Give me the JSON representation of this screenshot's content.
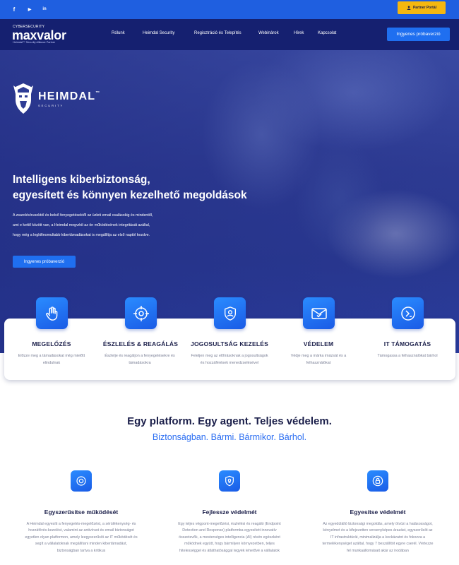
{
  "topbar": {
    "social": [
      {
        "name": "facebook",
        "glyph": "f"
      },
      {
        "name": "youtube",
        "glyph": "▶"
      },
      {
        "name": "linkedin",
        "glyph": "in"
      }
    ],
    "partner_label": "Partner Portál"
  },
  "nav": {
    "logo_small": "CYBERSECURITY",
    "logo_main": "maxvalor",
    "logo_tag": "Heimdal™ Security Alliance Partner",
    "items": [
      "Rólunk",
      "Heimdal Security",
      "Regisztráció és Telepítés",
      "Webinárok",
      "Hírek",
      "Kapcsolat"
    ],
    "cta": "Ingyenes próbaverzió"
  },
  "hero": {
    "brand": "HEIMDAL",
    "brand_tm": "™",
    "brand_sub": "SECURITY",
    "title_line1": "Intelligens kiberbiztonság,",
    "title_line2": "egyesített és könnyen kezelhető megoldások",
    "text_line1": "A zsarolóvírusoktól és belső fenyegetésektől az üzleti email csalásokig és mindentől,",
    "text_line2": "ami e kettő között van, a Heimdal megvédi az ön működésének integritását azáltal,",
    "text_line3": "hogy még a legkifinomultabb kibertámadásokat is megállítja az első naptól kezdve.",
    "button": "Ingyenes próbaverzió"
  },
  "features": [
    {
      "title": "MEGELŐZÉS",
      "desc": "Előzze meg a támadásokat még mielőtt elindulnak",
      "icon": "hand-icon"
    },
    {
      "title": "ÉSZLELÉS & REAGÁLÁS",
      "desc": "Észlelje és reagáljon a fenyegetésekre és támadásokra",
      "icon": "crosshair-icon"
    },
    {
      "title": "JOGOSULTSÁG KEZELÉS",
      "desc": "Feleljen meg az előírásoknak a jogosultságok és hozzáférések menedzselésével",
      "icon": "user-shield-icon"
    },
    {
      "title": "VÉDELEM",
      "desc": "Védje meg a márka imázsát és a felhasználókat",
      "icon": "mail-check-icon"
    },
    {
      "title": "IT TÁMOGATÁS",
      "desc": "Támogassa a felhasználókat bárhol",
      "icon": "remote-icon"
    }
  ],
  "platform": {
    "title": "Egy platform. Egy agent. Teljes védelem.",
    "subtitle": "Biztonságban. Bármi. Bármikor. Bárhol."
  },
  "columns": [
    {
      "title": "Egyszerűsítse működését",
      "icon": "target-icon",
      "text": "A Heimdal egyesíti a fenyegetés-megelőzést, a sérülékenység- és hozzáférés-kezelést, valamint az antivírust és email biztonságot egyetlen olyan platformon, amely leegyszerűsíti az IT működését és segít a vállalatoknak megállítani minden kibertámadást, biztonságban tartva a kritikus"
    },
    {
      "title": "Fejlessze védelmét",
      "icon": "bulb-shield-icon",
      "text": "Egy teljes végpont-megelőzési, észlelési és reagáló (Endpoint Detection and Response) platformba egyesített innovatív összetevők, a mesterséges intelligencia (AI) révén egészként működnek együtt, hogy bármilyen környezetben, teljes hitelességgel és átláthatósággal tegyék lehetővé a vállalatok"
    },
    {
      "title": "Egyesítse védelmét",
      "icon": "lock-icon",
      "text": "Az egyedülálló biztonsági megoldás, amely ötvözi a hatásosságot, kényelmet és a kifejezetten versenyképes árazást, egyszerűsíti az IT infrastruktúrát, minimalizálja a kockázatot és fokozza a termelékenységet azáltal, hogy 7 beszállítót egyre cserél. Vértezze fel munkaállomásait akár az irodában"
    }
  ]
}
